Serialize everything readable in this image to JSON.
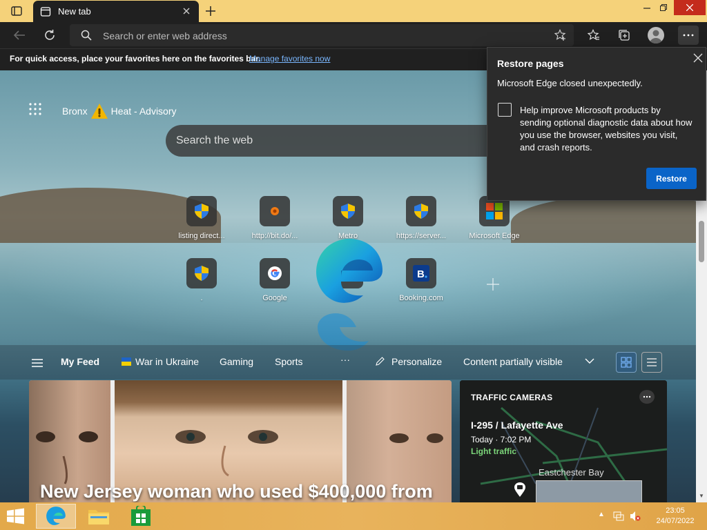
{
  "browser": {
    "tab_title": "New tab",
    "address_placeholder": "Search or enter web address"
  },
  "favorites_bar": {
    "message": "For quick access, place your favorites here on the favorites bar.",
    "link": "Manage favorites now"
  },
  "ntp": {
    "location": "Bronx",
    "weather_alert": "Heat - Advisory",
    "search_placeholder": "Search the web",
    "quick_links": [
      {
        "label": "listing direct...",
        "icon": "shield-icon"
      },
      {
        "label": "http://bit.do/...",
        "icon": "orange-dot-icon"
      },
      {
        "label": "Metro",
        "icon": "shield-icon"
      },
      {
        "label": "https://server...",
        "icon": "shield-icon"
      },
      {
        "label": "Microsoft Edge",
        "icon": "microsoft-logo-icon"
      },
      {
        "label": ".",
        "icon": "shield-icon"
      },
      {
        "label": "Google",
        "icon": "google-icon"
      },
      {
        "label": ".",
        "icon": "shield-icon"
      },
      {
        "label": "Booking.com",
        "icon": "booking-icon"
      }
    ]
  },
  "feed_nav": {
    "my_feed": "My Feed",
    "war": "War in Ukraine",
    "gaming": "Gaming",
    "sports": "Sports",
    "more": "···",
    "personalize": "Personalize",
    "content_visibility": "Content partially visible"
  },
  "cards": {
    "headline": "New Jersey woman who used $400,000 from",
    "traffic": {
      "title": "TRAFFIC CAMERAS",
      "location": "I-295 / Lafayette Ave",
      "time": "Today · 7:02 PM",
      "status": "Light traffic",
      "place": "Eastchester Bay"
    }
  },
  "popup": {
    "title": "Restore pages",
    "message": "Microsoft Edge closed unexpectedly.",
    "checkbox_label": "Help improve Microsoft products by sending optional diagnostic data about how you use the browser, websites you visit, and crash reports.",
    "button": "Restore"
  },
  "taskbar": {
    "time": "23:05",
    "date": "24/07/2022"
  },
  "colors": {
    "title_bar": "#f5d27a",
    "accent_blue": "#0a64c8",
    "taskbar": "#e3a94a"
  }
}
